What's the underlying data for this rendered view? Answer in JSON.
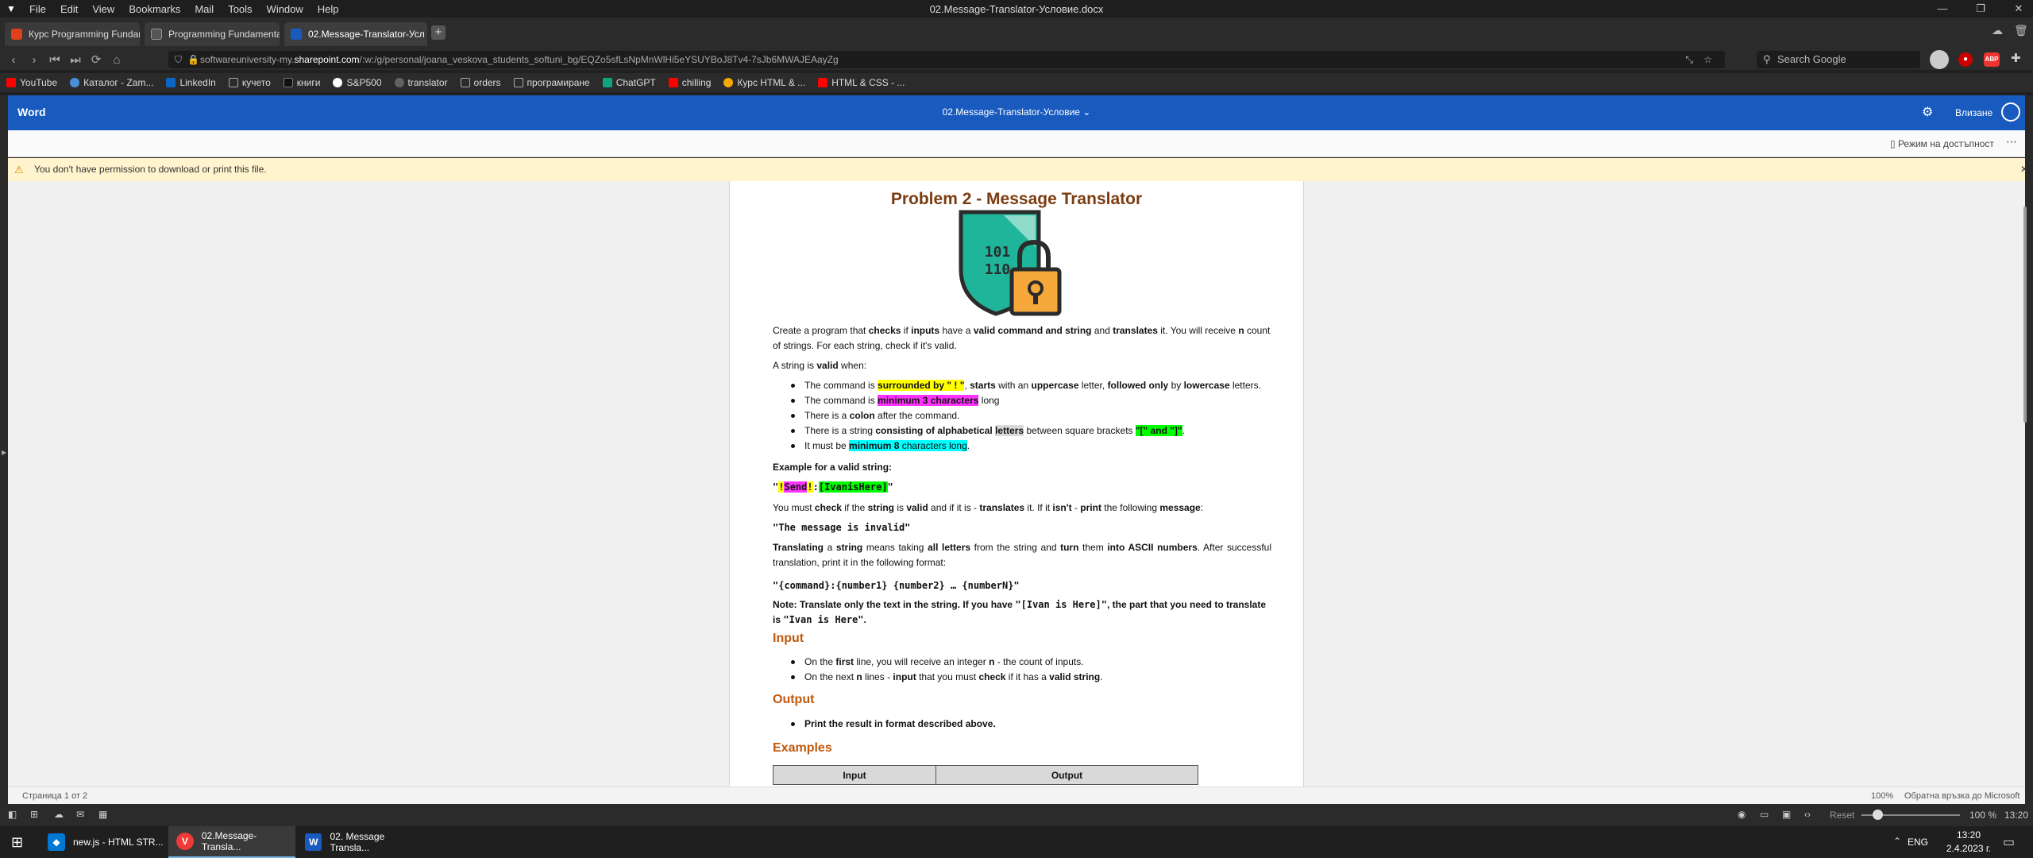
{
  "menubar": {
    "items": [
      "File",
      "Edit",
      "View",
      "Bookmarks",
      "Mail",
      "Tools",
      "Window",
      "Help"
    ],
    "window_title": "02.Message-Translator-Условие.docx"
  },
  "tabs": [
    {
      "label": "Курс Programming Fundam",
      "color": "#e0401a"
    },
    {
      "label": "Programming Fundamenta",
      "color": "#444444"
    },
    {
      "label": "02.Message-Translator-Усл",
      "color": "#185abd"
    }
  ],
  "address": {
    "url_pre": "softwareuniversity-my.",
    "url_host": "sharepoint.com",
    "url_post": "/:w:/g/personal/joana_veskova_students_softuni_bg/EQZo5sfLsNpMnWlHi5eYSUYBoJ8Tv4-7sJb6MWAJEAayZg",
    "search_placeholder": "Search Google"
  },
  "bookmarks": [
    {
      "label": "YouTube",
      "color": "#ff0000"
    },
    {
      "label": "Каталог - Zam...",
      "color": "#4a90d9"
    },
    {
      "label": "LinkedIn",
      "color": "#0a66c2"
    },
    {
      "label": "кучето",
      "color": "#888888"
    },
    {
      "label": "книги",
      "color": "#222222"
    },
    {
      "label": "S&P500",
      "color": "#ffffff"
    },
    {
      "label": "translator",
      "color": "#5f6368"
    },
    {
      "label": "orders",
      "color": "#888888"
    },
    {
      "label": "програмиране",
      "color": "#888888"
    },
    {
      "label": "ChatGPT",
      "color": "#10a37f"
    },
    {
      "label": "chilling",
      "color": "#ff0000"
    },
    {
      "label": "Курс HTML & ...",
      "color": "#f2a900"
    },
    {
      "label": "HTML & CSS - ...",
      "color": "#ff0000"
    }
  ],
  "word": {
    "app_name": "Word",
    "doc_title": "02.Message-Translator-Условие",
    "signin": "Влизане",
    "accessibility": "Режим на достъпност",
    "info_msg": "You don't have permission to download or print this file."
  },
  "doc": {
    "title": "Problem 2 - Message Translator",
    "shield_code_1": "101",
    "shield_code_2": "110",
    "intro": {
      "a": "Create a program that ",
      "b": "checks",
      "c": " if ",
      "d": "inputs",
      "e": " have a ",
      "f": "valid command and string",
      "g": " and ",
      "h": "translates",
      "i": " it. You will receive ",
      "j": "n",
      "k": " count of strings. For each string, check if it's valid."
    },
    "valid_intro": {
      "a": "A string is ",
      "b": "valid",
      "c": " when:"
    },
    "rules": {
      "r1": {
        "a": "The command is ",
        "b": "surrounded by \" ! \"",
        "c": ", ",
        "d": "starts",
        "e": " with an ",
        "f": "uppercase",
        "g": " letter, ",
        "h": "followed only",
        "i": " by ",
        "j": "lowercase",
        "k": " letters."
      },
      "r2": {
        "a": "The command is ",
        "b": "minimum 3 characters",
        "c": " long"
      },
      "r3": {
        "a": "There is a ",
        "b": "colon",
        "c": " after the command."
      },
      "r4": {
        "a": "There is a string ",
        "b": "consisting of alphabetical",
        "c": "letters",
        "d": " between square brackets ",
        "e": "\"[\" and \"]\"",
        "f": "."
      },
      "r5": {
        "a": "It must be ",
        "b": "minimum 8",
        "c": " characters long",
        "d": "."
      }
    },
    "example_heading": "Example for a valid string:",
    "example": {
      "q1": "\"",
      "ex1": "!",
      "cmd": "Send",
      "ex2": "!",
      "colon": ":",
      "brk": "[IvanisHere]",
      "q2": "\""
    },
    "check_line": {
      "a": "You must ",
      "b": "check",
      "c": " if the ",
      "d": "string",
      "e": " is ",
      "f": "valid",
      "g": " and if it is - ",
      "h": "translates",
      "i": " it. If it ",
      "j": "isn't",
      "k": " - ",
      "l": "print",
      "m": " the following ",
      "n": "message",
      ":": ":"
    },
    "invalid_msg": "\"The message is invalid\"",
    "translate_line": {
      "a": "Translating",
      "b": " a ",
      "c": "string",
      "d": " means taking ",
      "e": "all letters",
      "f": " from the string and ",
      "g": "turn",
      "h": " them ",
      "i": "into ASCII numbers",
      "j": ". After successful translation, print it in the following format:"
    },
    "format": "\"{command}:{number1} {number2} … {numberN}\"",
    "note": {
      "a": "Note: Translate only the text in the string. If you have ",
      "b": "\"[Ivan is Here]\"",
      "c": ", the part that you need to translate is ",
      "d": "\"Ivan is Here\"",
      "e": "."
    },
    "input_heading": "Input",
    "input_items": {
      "i1": {
        "a": "On the ",
        "b": "first",
        "c": " line, you will receive an integer ",
        "d": "n",
        "e": " - the count of inputs."
      },
      "i2": {
        "a": "On the next ",
        "b": "n",
        "c": " lines - ",
        "d": "input",
        "e": " that you must ",
        "f": "check",
        "g": " if it has a ",
        "h": "valid string",
        "i": "."
      }
    },
    "output_heading": "Output",
    "output_item": "Print the result in format described above.",
    "examples_heading": "Examples",
    "table_headers": [
      "Input",
      "Output"
    ]
  },
  "status": {
    "page": "Страница 1 от 2",
    "zoom": "100%",
    "feedback": "Обратна връзка до Microsoft"
  },
  "vivaldi_status": {
    "reset": "Reset",
    "zoom": "100 %",
    "time": "13:20"
  },
  "taskbar": {
    "items": [
      {
        "label": "new.js - HTML STR...",
        "color": "#0078d4",
        "glyph": "◆"
      },
      {
        "label": "02.Message-Transla...",
        "color": "#ef3939",
        "glyph": "V"
      },
      {
        "label": "02. Message Transla...",
        "color": "#185abd",
        "glyph": "W"
      }
    ],
    "lang": "ENG",
    "time": "13:20",
    "date": "2.4.2023 г."
  }
}
